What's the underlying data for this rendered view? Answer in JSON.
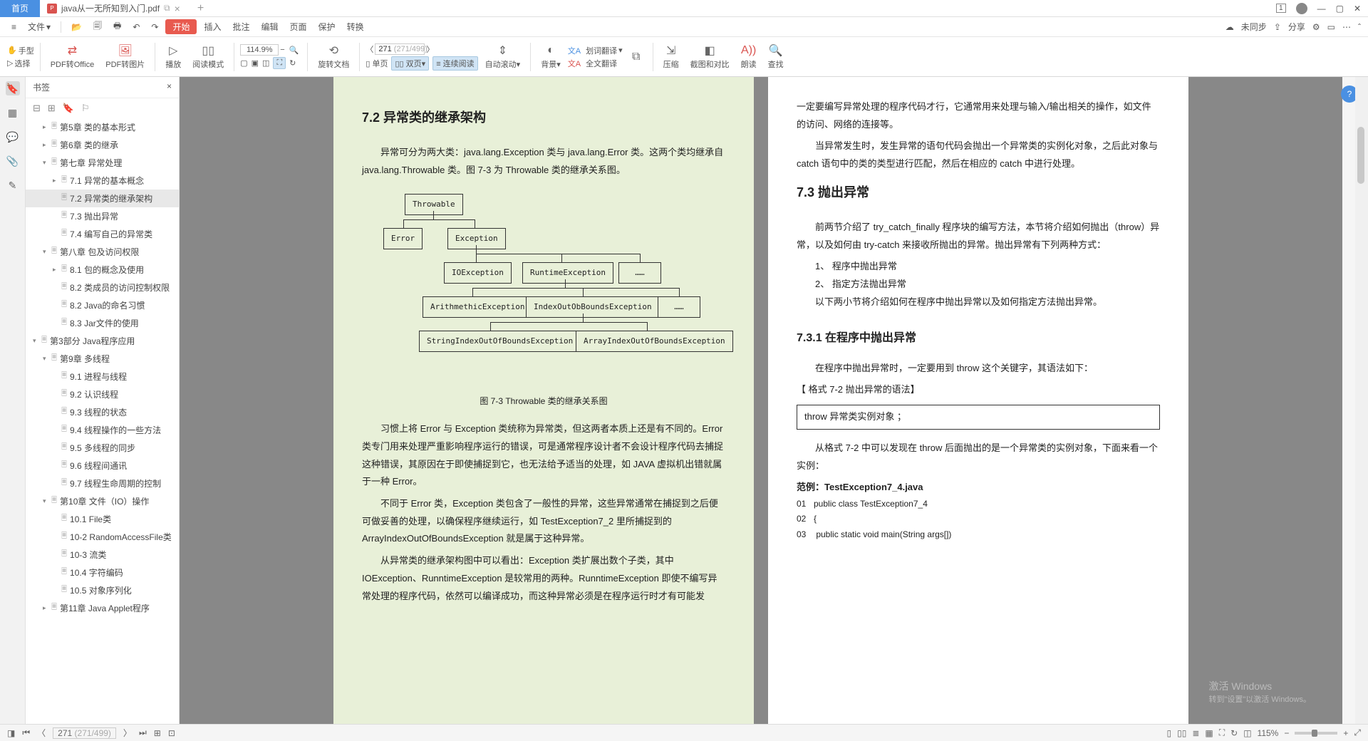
{
  "title_bar": {
    "home": "首页",
    "doc_title": "java从一无所知到入门.pdf",
    "pdf_badge": "P"
  },
  "menu": {
    "file": "文件",
    "start": "开始",
    "items": [
      "插入",
      "批注",
      "编辑",
      "页面",
      "保护",
      "转换"
    ],
    "unsync": "未同步",
    "share": "分享"
  },
  "toolbar": {
    "hand": "手型",
    "select": "选择",
    "pdf_office": "PDF转Office",
    "pdf_img": "PDF转图片",
    "play": "播放",
    "read_mode": "阅读模式",
    "zoom": "114.9%",
    "page_current": "271",
    "page_total": "(271/499)",
    "rotate": "旋转文档",
    "single": "单页",
    "double": "双页",
    "cont": "连续阅读",
    "autoscroll": "自动滚动",
    "bg": "背景",
    "word_trans": "划词翻译",
    "full_trans": "全文翻译",
    "compress": "压缩",
    "compare": "截图和对比",
    "read_aloud": "朗读",
    "find": "查找"
  },
  "bookmarks": {
    "title": "书签",
    "items": [
      {
        "lvl": 2,
        "t": "▸",
        "label": "第5章 类的基本形式"
      },
      {
        "lvl": 2,
        "t": "▸",
        "label": "第6章 类的继承"
      },
      {
        "lvl": 2,
        "t": "▾",
        "label": "第七章 异常处理"
      },
      {
        "lvl": 3,
        "t": "▸",
        "label": "7.1 异常的基本概念"
      },
      {
        "lvl": 3,
        "t": "",
        "label": "7.2 异常类的继承架构",
        "sel": true
      },
      {
        "lvl": 3,
        "t": "",
        "label": "7.3 抛出异常"
      },
      {
        "lvl": 3,
        "t": "",
        "label": "7.4 编写自己的异常类"
      },
      {
        "lvl": 2,
        "t": "▾",
        "label": "第八章 包及访问权限"
      },
      {
        "lvl": 3,
        "t": "▸",
        "label": "8.1 包的概念及使用"
      },
      {
        "lvl": 3,
        "t": "",
        "label": "8.2 类成员的访问控制权限"
      },
      {
        "lvl": 3,
        "t": "",
        "label": "8.2 Java的命名习惯"
      },
      {
        "lvl": 3,
        "t": "",
        "label": "8.3 Jar文件的使用"
      },
      {
        "lvl": 1,
        "t": "▾",
        "label": "第3部分 Java程序应用"
      },
      {
        "lvl": 2,
        "t": "▾",
        "label": "第9章 多线程"
      },
      {
        "lvl": 3,
        "t": "",
        "label": "9.1 进程与线程"
      },
      {
        "lvl": 3,
        "t": "",
        "label": "9.2 认识线程"
      },
      {
        "lvl": 3,
        "t": "",
        "label": "9.3 线程的状态"
      },
      {
        "lvl": 3,
        "t": "",
        "label": "9.4 线程操作的一些方法"
      },
      {
        "lvl": 3,
        "t": "",
        "label": "9.5 多线程的同步"
      },
      {
        "lvl": 3,
        "t": "",
        "label": "9.6 线程间通讯"
      },
      {
        "lvl": 3,
        "t": "",
        "label": "9.7 线程生命周期的控制"
      },
      {
        "lvl": 2,
        "t": "▾",
        "label": "第10章 文件（IO）操作"
      },
      {
        "lvl": 3,
        "t": "",
        "label": "10.1 File类"
      },
      {
        "lvl": 3,
        "t": "",
        "label": "10-2 RandomAccessFile类"
      },
      {
        "lvl": 3,
        "t": "",
        "label": "10-3 流类"
      },
      {
        "lvl": 3,
        "t": "",
        "label": "10.4 字符编码"
      },
      {
        "lvl": 3,
        "t": "",
        "label": "10.5 对象序列化"
      },
      {
        "lvl": 2,
        "t": "▸",
        "label": "第11章 Java Applet程序"
      }
    ]
  },
  "page_left": {
    "h1": "7.2  异常类的继承架构",
    "p1": "异常可分为两大类：java.lang.Exception 类与 java.lang.Error 类。这两个类均继承自 java.lang.Throwable 类。图 7-3 为 Throwable 类的继承关系图。",
    "diagram": {
      "n1": "Throwable",
      "n2": "Error",
      "n3": "Exception",
      "n4": "IOException",
      "n5": "RuntimeException",
      "n6": "……",
      "n7": "ArithmethicException",
      "n8": "IndexOutObBoundsException",
      "n9": "……",
      "n10": "StringIndexOutOfBoundsException",
      "n11": "ArrayIndexOutOfBoundsException"
    },
    "caption": "图 7-3    Throwable 类的继承关系图",
    "p2": "习惯上将 Error 与 Exception 类统称为异常类，但这两者本质上还是有不同的。Error 类专门用来处理严重影响程序运行的错误，可是通常程序设计者不会设计程序代码去捕捉这种错误，其原因在于即使捕捉到它，也无法给予适当的处理，如 JAVA 虚拟机出错就属于一种 Error。",
    "p3": "不同于 Error 类，Exception 类包含了一般性的异常，这些异常通常在捕捉到之后便可做妥善的处理，以确保程序继续运行，如 TestException7_2 里所捕捉到的 ArrayIndexOutOfBoundsException 就是属于这种异常。",
    "p4": "从异常类的继承架构图中可以看出：Exception 类扩展出数个子类，其中 IOException、RunntimeException 是较常用的两种。RunntimeException 即使不编写异常处理的程序代码，依然可以编译成功，而这种异常必须是在程序运行时才有可能发"
  },
  "page_right": {
    "p1": "一定要编写异常处理的程序代码才行，它通常用来处理与输入/输出相关的操作，如文件的访问、网络的连接等。",
    "p2": "当异常发生时，发生异常的语句代码会抛出一个异常类的实例化对象，之后此对象与 catch 语句中的类的类型进行匹配，然后在相应的 catch 中进行处理。",
    "h2": "7.3  抛出异常",
    "p3": "前两节介绍了 try_catch_finally 程序块的编写方法，本节将介绍如何抛出（throw）异常，以及如何由 try-catch 来接收所抛出的异常。抛出异常有下列两种方式：",
    "li1": "1、 程序中抛出异常",
    "li2": "2、 指定方法抛出异常",
    "p4": "以下两小节将介绍如何在程序中抛出异常以及如何指定方法抛出异常。",
    "h3": "7.3.1  在程序中抛出异常",
    "p5": "在程序中抛出异常时，一定要用到 throw 这个关键字，其语法如下：",
    "fmt": "【 格式 7-2  抛出异常的语法】",
    "codebox": "throw  异常类实例对象 ；",
    "p6": "从格式 7-2 中可以发现在 throw 后面抛出的是一个异常类的实例对象，下面来看一个实例：",
    "ex_title": "范例：TestException7_4.java",
    "code": [
      {
        "n": "01",
        "t": "public class TestException7_4"
      },
      {
        "n": "02",
        "t": "{"
      },
      {
        "n": "03",
        "t": "    public static void main(String args[])"
      }
    ]
  },
  "watermark": {
    "l1": "激活 Windows",
    "l2": "转到\"设置\"以激活 Windows。"
  },
  "status": {
    "page_cur": "271",
    "page_tot": "(271/499)",
    "zoom": "115%"
  }
}
